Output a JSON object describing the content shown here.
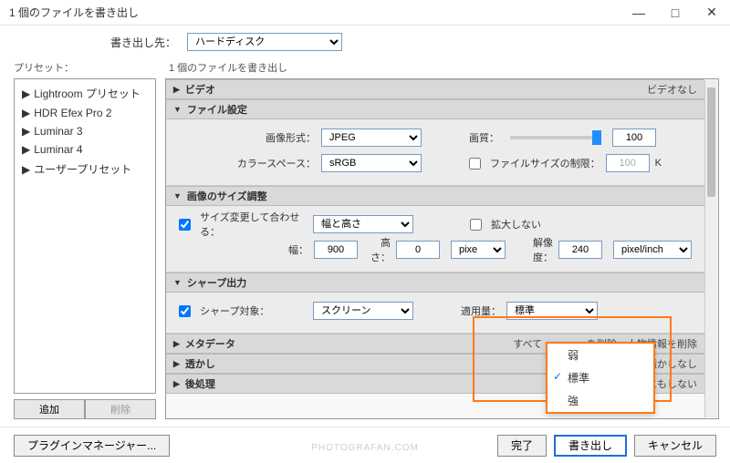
{
  "window": {
    "title": "1 個のファイルを書き出し"
  },
  "dest": {
    "label": "書き出し先：",
    "value": "ハードディスク"
  },
  "presets": {
    "label": "プリセット：",
    "items": [
      {
        "label": "Lightroom プリセット"
      },
      {
        "label": "HDR Efex Pro 2"
      },
      {
        "label": "Luminar 3"
      },
      {
        "label": "Luminar 4"
      },
      {
        "label": "ユーザープリセット"
      }
    ],
    "add": "追加",
    "remove": "削除"
  },
  "right_label": "1 個のファイルを書き出し",
  "sections": {
    "video": {
      "title": "ビデオ",
      "right": "ビデオなし"
    },
    "file": {
      "title": "ファイル設定",
      "format_lbl": "画像形式：",
      "format_val": "JPEG",
      "quality_lbl": "画質：",
      "quality_val": "100",
      "cspace_lbl": "カラースペース：",
      "cspace_val": "sRGB",
      "limit_lbl": "ファイルサイズの制限：",
      "limit_val": "100",
      "limit_unit": "K"
    },
    "resize": {
      "title": "画像のサイズ調整",
      "fit_lbl": "サイズ変更して合わせる：",
      "fit_val": "幅と高さ",
      "noenlarge_lbl": "拡大しない",
      "w_lbl": "幅：",
      "w_val": "900",
      "h_lbl": "高さ：",
      "h_val": "0",
      "unit_val": "pixel",
      "res_lbl": "解像度：",
      "res_val": "240",
      "res_unit": "pixel/inch"
    },
    "sharpen": {
      "title": "シャープ出力",
      "target_lbl": "シャープ対象：",
      "target_val": "スクリーン",
      "amount_lbl": "適用量：",
      "amount_val": "標準",
      "options": [
        "弱",
        "標準",
        "強"
      ]
    },
    "meta": {
      "title": "メタデータ",
      "right": "すべて",
      "right2": "を削除、人物情報を削除"
    },
    "watermark": {
      "title": "透かし",
      "right": "透かしなし"
    },
    "post": {
      "title": "後処理",
      "right": "なにもしない"
    }
  },
  "bottom": {
    "plugin": "プラグインマネージャー...",
    "done": "完了",
    "export": "書き出し",
    "cancel": "キャンセル"
  },
  "watermark_text": "PHOTOGRAFAN.COM"
}
